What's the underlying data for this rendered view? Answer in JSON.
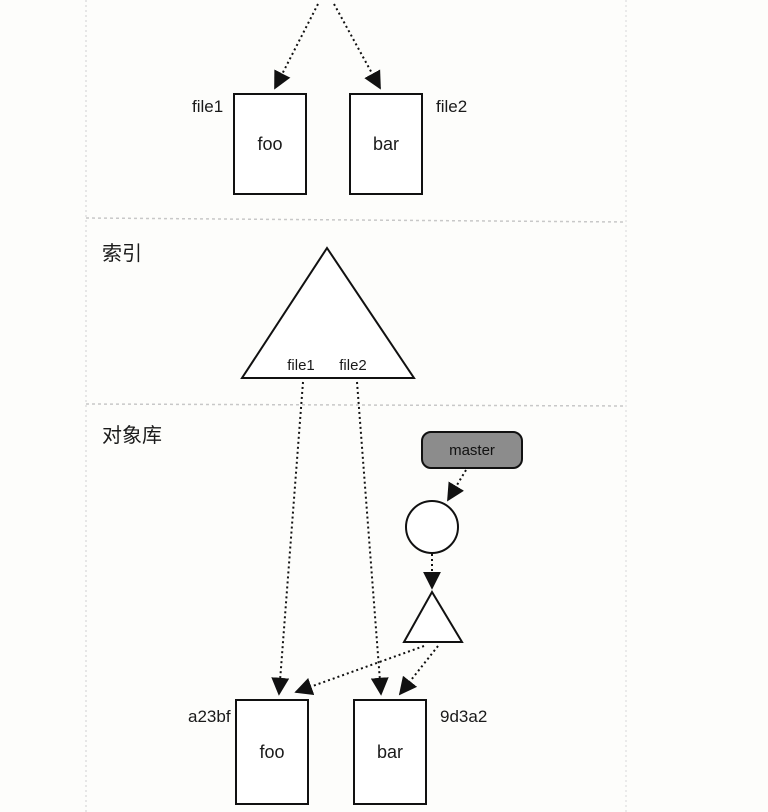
{
  "sections": {
    "index_label": "索引",
    "object_store_label": "对象库"
  },
  "working_dir": {
    "file1_name": "file1",
    "file2_name": "file2",
    "file1_content": "foo",
    "file2_content": "bar"
  },
  "index": {
    "entry1": "file1",
    "entry2": "file2"
  },
  "object_store": {
    "branch": "master",
    "blob1_hash": "a23bf",
    "blob2_hash": "9d3a2",
    "blob1_content": "foo",
    "blob2_content": "bar"
  },
  "colors": {
    "branch_fill": "#8c8c8c",
    "stroke": "#111111",
    "divider": "#c8c8c8"
  }
}
